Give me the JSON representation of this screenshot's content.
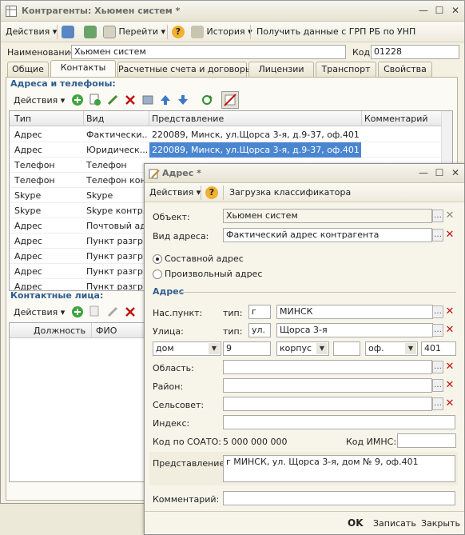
{
  "main": {
    "title": "Контрагенты: Хьюмен систем *",
    "toolbar": {
      "actions": "Действия",
      "goto": "Перейти",
      "history": "История",
      "get_data": "Получить данные с ГРП РБ по УНП"
    },
    "name_label": "Наименование:",
    "name_value": "Хьюмен систем",
    "code_label": "Код:",
    "code_value": "01228",
    "tabs": [
      "Общие",
      "Контакты",
      "Расчетные счета и договоры",
      "Лицензии",
      "Транспорт",
      "Свойства"
    ],
    "active_tab": "Контакты",
    "addresses": {
      "title": "Адреса и телефоны:",
      "actions": "Действия",
      "columns": [
        "Тип",
        "Вид",
        "Представление",
        "Комментарий"
      ],
      "rows": [
        {
          "type": "Адрес",
          "kind": "Фактически...",
          "repr": "220089, Минск, ул.Щорса 3-я, д.9-37, оф.401"
        },
        {
          "type": "Адрес",
          "kind": "Юридическ...",
          "repr": "220089, Минск, ул.Щорса 3-я, д.9-37, оф.401"
        },
        {
          "type": "Телефон",
          "kind": "Телефон",
          "repr": ""
        },
        {
          "type": "Телефон",
          "kind": "Телефон кон...",
          "repr": ""
        },
        {
          "type": "Skype",
          "kind": "Skype",
          "repr": ""
        },
        {
          "type": "Skype",
          "kind": "Skype контр...",
          "repr": ""
        },
        {
          "type": "Адрес",
          "kind": "Почтовый ад...",
          "repr": ""
        },
        {
          "type": "Адрес",
          "kind": "Пункт разгр...",
          "repr": ""
        },
        {
          "type": "Адрес",
          "kind": "Пункт разгр...",
          "repr": ""
        },
        {
          "type": "Адрес",
          "kind": "Пункт разгр...",
          "repr": ""
        },
        {
          "type": "Адрес",
          "kind": "Пункт разгр...",
          "repr": ""
        }
      ]
    },
    "contacts": {
      "title": "Контактные лица:",
      "actions": "Действия",
      "columns": [
        "Должность",
        "ФИО"
      ]
    }
  },
  "address_dialog": {
    "title": "Адрес *",
    "actions": "Действия",
    "load_classifier": "Загрузка классификатора",
    "object_label": "Объект:",
    "object_value": "Хьюмен систем",
    "addr_kind_label": "Вид адреса:",
    "addr_kind_value": "Фактический адрес контрагента",
    "radio_composite": "Составной адрес",
    "radio_free": "Произвольный адрес",
    "section_address": "Адрес",
    "locality_label": "Нас.пункт:",
    "type_label": "тип:",
    "locality_type": "г",
    "locality_value": "МИНСК",
    "street_label": "Улица:",
    "street_type": "ул.",
    "street_value": "Щорса 3-я",
    "house_kind": "дом",
    "house_value": "9",
    "building_kind": "корпус",
    "building_value": "",
    "office_kind": "оф.",
    "office_value": "401",
    "region_label": "Область:",
    "district_label": "Район:",
    "council_label": "Сельсовет:",
    "index_label": "Индекс:",
    "soato_label": "Код по СОАТО:",
    "soato_value": "5 000 000 000",
    "imns_label": "Код ИМНС:",
    "repr_label": "Представление:",
    "repr_value": "г МИНСК, ул. Щорса 3-я, дом № 9, оф.401",
    "comment_label": "Комментарий:",
    "ok": "OK",
    "save": "Записать",
    "close": "Закрыть"
  },
  "colors": {
    "selection": "#4a86d0",
    "section_title": "#2e5d8e",
    "delete": "#c01010",
    "add": "#3fa33f"
  }
}
